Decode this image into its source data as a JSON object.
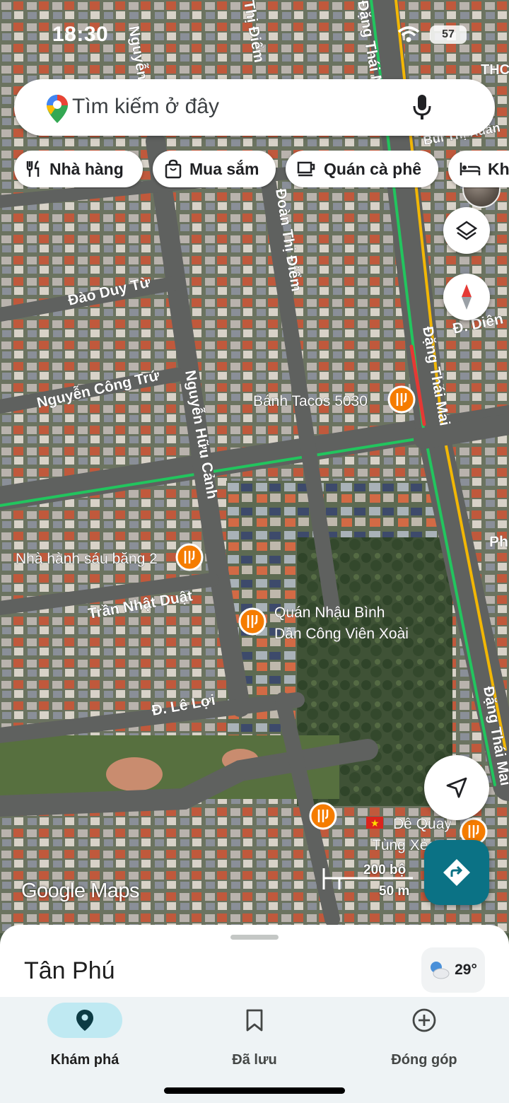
{
  "status_bar": {
    "time": "18:30",
    "battery": "57"
  },
  "search": {
    "placeholder": "Tìm kiếm ở đây"
  },
  "chips": [
    {
      "label": "Nhà hàng",
      "icon": "restaurant-icon"
    },
    {
      "label": "Mua sắm",
      "icon": "shopping-bag-icon"
    },
    {
      "label": "Quán cà phê",
      "icon": "coffee-icon"
    },
    {
      "label": "Khá",
      "icon": "hotel-bed-icon"
    }
  ],
  "map": {
    "streets": [
      "Đào Duy Từ",
      "Nguyễn Công Trứ",
      "Nguyễn Hữu Cảnh",
      "Đoàn Thị Điểm",
      "Đặng Thái Mai",
      "Trần Nhật Duật",
      "Đ. Lê Lợi",
      "Đ. Diên",
      "Đặng Thái Mai",
      "Nguyễn",
      "Thị Điểm",
      "Đặng Thái Mai",
      "Bùi Thị Xuân",
      "THC",
      "Ph"
    ],
    "pois": [
      {
        "name": "Bánh Tacos 5030",
        "icon": "restaurant-pin-icon"
      },
      {
        "name": "Nhà hành sáu băng 2",
        "icon": "restaurant-pin-icon"
      },
      {
        "name": "Quán Nhậu Bình",
        "name2": "Dân Công Viên Xoài",
        "icon": "restaurant-pin-icon"
      },
      {
        "name": "Dê Quay",
        "name2": "Tùng Xẻo",
        "icon": "restaurant-pin-icon"
      }
    ],
    "brand": "Google Maps",
    "scale": {
      "imperial": "200 bộ",
      "metric": "50 m"
    }
  },
  "sheet": {
    "place": "Tân Phú",
    "temperature": "29°"
  },
  "bottom_nav": [
    {
      "label": "Khám phá",
      "icon": "explore-pin-icon",
      "active": true
    },
    {
      "label": "Đã lưu",
      "icon": "bookmark-icon",
      "active": false
    },
    {
      "label": "Đóng góp",
      "icon": "add-circle-icon",
      "active": false
    }
  ],
  "colors": {
    "accent": "#0b7285",
    "traffic_green": "#22c55e",
    "traffic_yellow": "#f2b705",
    "traffic_red": "#e53935",
    "poi": "#f57c00"
  }
}
